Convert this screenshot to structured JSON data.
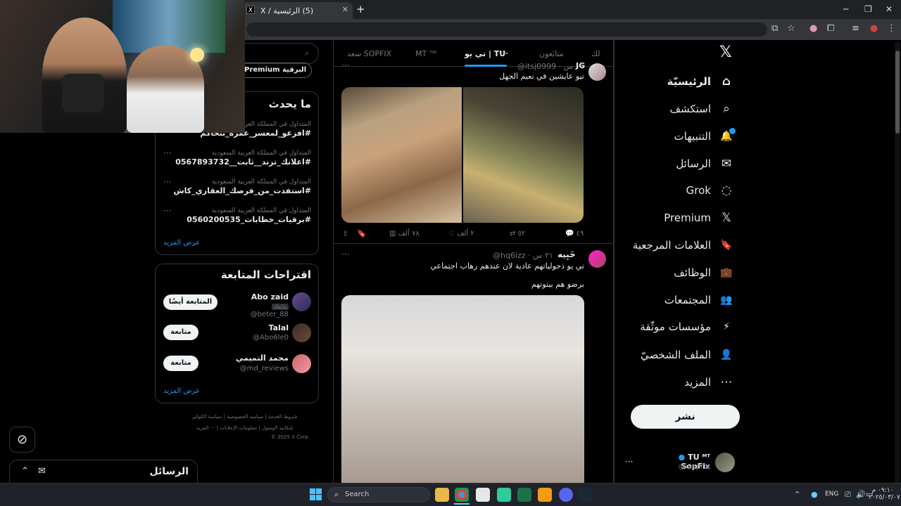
{
  "browser": {
    "tab_title": "(5) الرئيسية / X",
    "tab_favicon": "X",
    "new_tab": "+",
    "win_min": "─",
    "win_max": "❐",
    "win_close": "✕"
  },
  "nav": {
    "items": [
      {
        "label": "الرئيسيّة",
        "icon": "⌂"
      },
      {
        "label": "استكشف",
        "icon": "⌕"
      },
      {
        "label": "التنبيهات",
        "icon": "🔔"
      },
      {
        "label": "الرسائل",
        "icon": "✉"
      },
      {
        "label": "Grok",
        "icon": "◌"
      },
      {
        "label": "Premium",
        "icon": "𝕏"
      },
      {
        "label": "العلامات المرجعية",
        "icon": "🔖"
      },
      {
        "label": "الوظائف",
        "icon": "💼"
      },
      {
        "label": "المجتمعات",
        "icon": "👥"
      },
      {
        "label": "مؤسسات موثّقة",
        "icon": "⚡"
      },
      {
        "label": "الملف الشخصيّ",
        "icon": "👤"
      },
      {
        "label": "المزيد",
        "icon": "⋯"
      }
    ],
    "post_button": "نشر",
    "account_name": "TU ᴹᵀ SopFix",
    "account_handle": "@iSopFix",
    "account_more": "···"
  },
  "feed": {
    "tabs": [
      "لك",
      "متابَعون",
      "تي يو | TU",
      "MT ᵀᴹ",
      "سعد SOPFIX"
    ],
    "tweet1": {
      "handle_time": "@itsj0999 · ١١ س",
      "name": "JG",
      "text": "تيو عايشين في نعيم الجهل",
      "replies": "٤٩",
      "retweets": "٥٢",
      "likes": "٢ ألف",
      "views": "٧٨ ألف"
    },
    "tweet2": {
      "name": "خَبِيه",
      "handle_time": "@hq6izz · ٢١ س",
      "text1": "تي يو ذحولياتهم عادية لان عندهم رهاب اجتماعي",
      "text2": "برضو هم بيتوتهم"
    }
  },
  "sidebar": {
    "search_premium": "+Premium البرقية",
    "trends_title": "ما يحدث",
    "trends": [
      {
        "category": "المتداول في المملكة العربية",
        "name": "#افزعو_لمعسر_عمرة_بتحاكم"
      },
      {
        "category": "المتداول في المملكة العربية السعودية",
        "name": "#اعلانك_ترند__ثابت__0567893732"
      },
      {
        "category": "المتداول في المملكة العربية السعودية",
        "name": "#استفدت_من_فرصك_العقاري_كاش"
      },
      {
        "category": "المتداول في المملكة العربية السعودية",
        "name": "#برقيات_خطابات_0560200535"
      }
    ],
    "show_more": "عرض المزيد",
    "suggest_title": "اقتراحات المتابعة",
    "suggestions": [
      {
        "name": "Abo zaid",
        "handle": "@beter_88",
        "badge": "يتابعك",
        "button": "المتابعة أيضًا"
      },
      {
        "name": "Talal",
        "handle": "@Abo6le0",
        "badge": "",
        "button": "متابعة"
      },
      {
        "name": "محمد التميمي",
        "handle": "@md_reviews",
        "badge": "",
        "button": "متابعة"
      }
    ],
    "footer_row1": "شروط الخدمة | سياسة الخصوصية | سياسة الكوكيز",
    "footer_row2": "إمكانية الوصول | معلومات الإعلانات | ··· المزيد",
    "footer_copy": "© 2025 X Corp.",
    "messages_label": "الرسائل"
  },
  "taskbar": {
    "search_placeholder": "Search",
    "lang": "ENG",
    "time": "٠٩:١٠ م",
    "date": "٢٠٢٥/٠٣/٠٧"
  },
  "colors": {
    "accent": "#1d9bf0",
    "bg": "#000000",
    "border": "#2f3336"
  }
}
